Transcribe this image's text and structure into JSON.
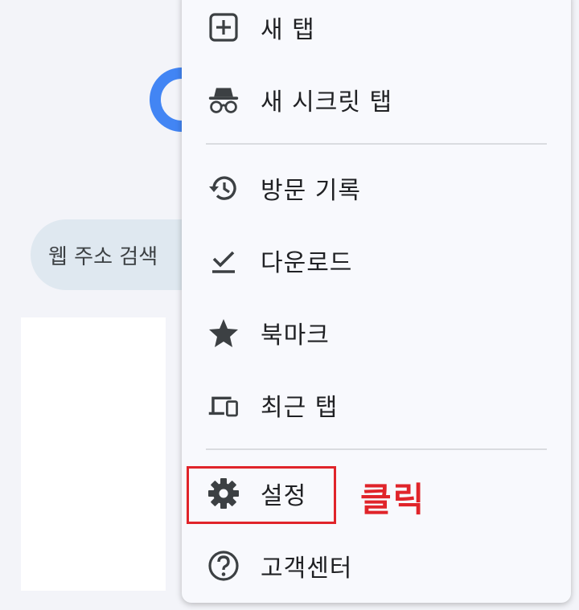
{
  "background": {
    "search_placeholder": "웹 주소 검색"
  },
  "menu": {
    "items": [
      {
        "label": "새 탭",
        "icon": "new-tab-icon"
      },
      {
        "label": "새 시크릿 탭",
        "icon": "incognito-icon"
      },
      {
        "label": "방문 기록",
        "icon": "history-icon"
      },
      {
        "label": "다운로드",
        "icon": "download-icon"
      },
      {
        "label": "북마크",
        "icon": "star-icon"
      },
      {
        "label": "최근 탭",
        "icon": "devices-icon"
      },
      {
        "label": "설정",
        "icon": "gear-icon"
      },
      {
        "label": "고객센터",
        "icon": "help-icon"
      }
    ]
  },
  "annotation": {
    "label": "클릭",
    "color": "#e0242a"
  },
  "colors": {
    "accent_blue": "#4285f4",
    "menu_bg": "#f8f9fd",
    "icon": "#3c4043"
  }
}
